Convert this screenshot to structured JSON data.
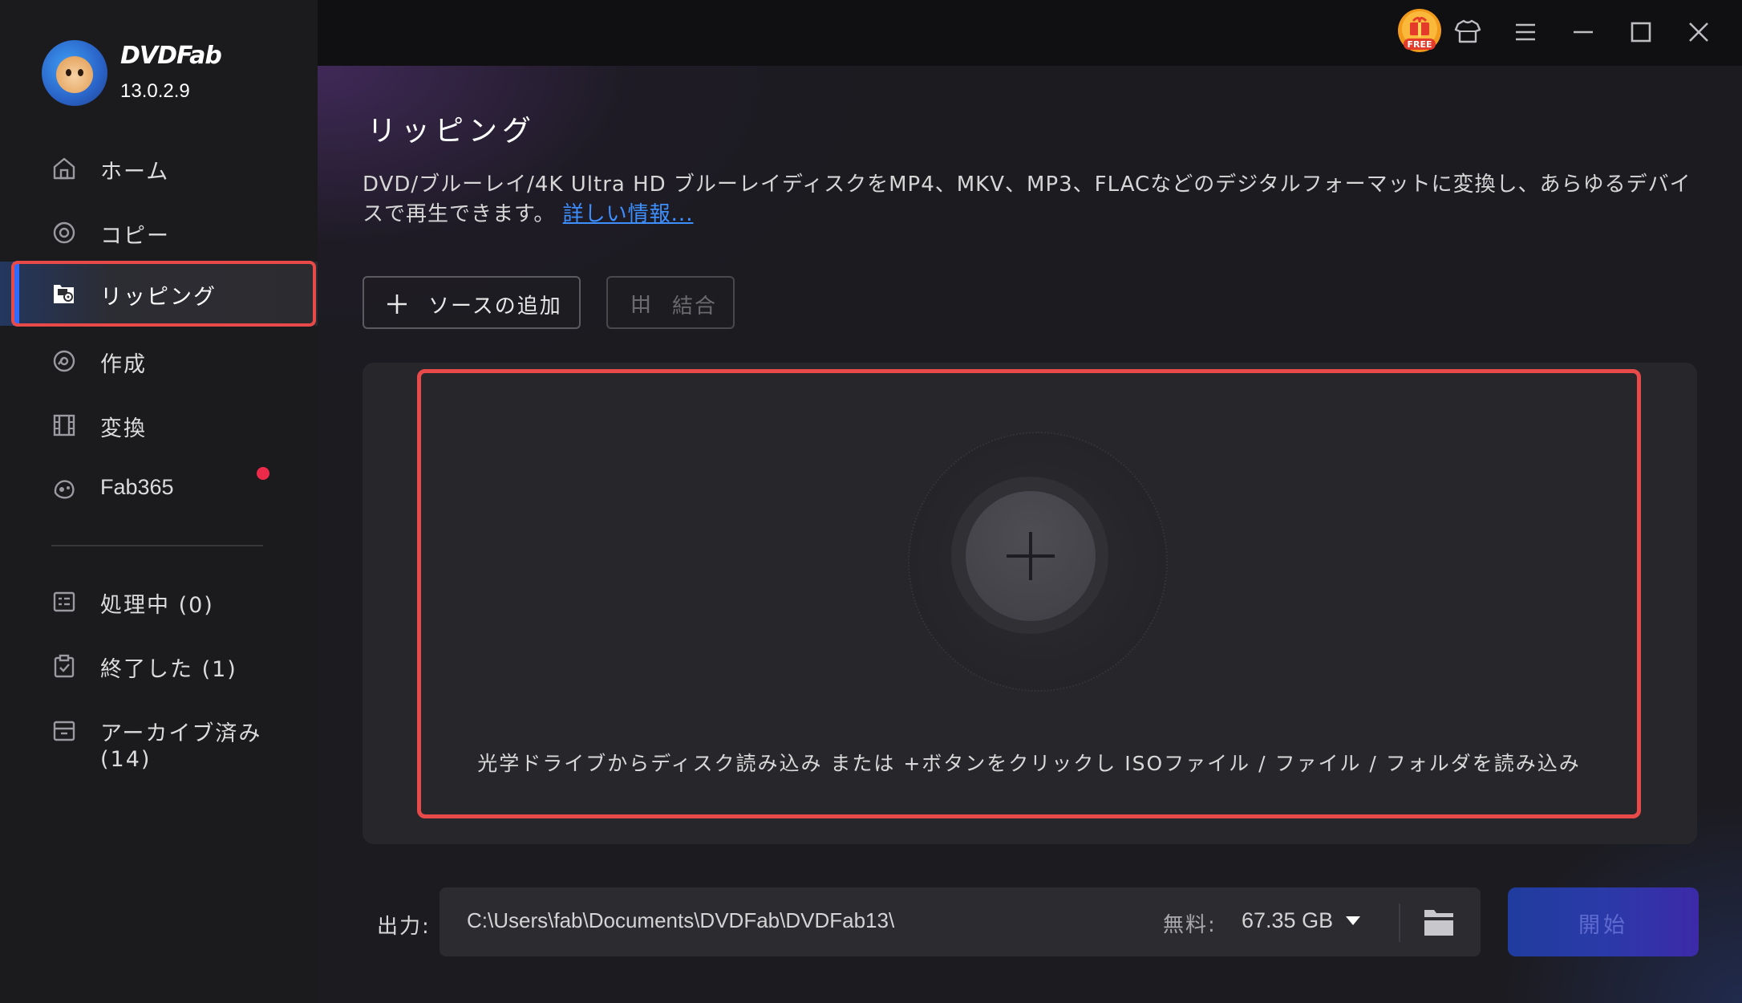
{
  "app": {
    "brand": "DVDFab",
    "version": "13.0.2.9"
  },
  "sidebar": {
    "items": [
      {
        "label": "ホーム",
        "icon": "home-icon"
      },
      {
        "label": "コピー",
        "icon": "copy-disc-icon"
      },
      {
        "label": "リッピング",
        "icon": "ripping-icon",
        "active": true
      },
      {
        "label": "作成",
        "icon": "create-disc-icon"
      },
      {
        "label": "変換",
        "icon": "convert-film-icon"
      },
      {
        "label": "Fab365",
        "icon": "fab365-icon",
        "badge": "red-dot"
      }
    ],
    "tasks": [
      {
        "label": "処理中 (0)",
        "icon": "processing-list-icon"
      },
      {
        "label": "終了した (1)",
        "icon": "finished-clipboard-icon"
      },
      {
        "label": "アーカイブ済み (14)",
        "icon": "archive-box-icon"
      }
    ]
  },
  "topbar": {
    "icons": [
      "free-gift-icon",
      "tshirt-skin-icon",
      "menu-icon",
      "minimize-icon",
      "maximize-icon",
      "close-icon"
    ],
    "free_badge": "FREE"
  },
  "main": {
    "title": "リッピング",
    "description": "DVD/ブルーレイ/4K Ultra HD ブルーレイディスクをMP4、MKV、MP3、FLACなどのデジタルフォーマットに変換し、あらゆるデバイスで再生できます。",
    "more_link": "詳しい情報...",
    "add_source_label": "ソースの追加",
    "merge_label": "結合",
    "drop_hint": "光学ドライブからディスク読み込み または +ボタンをクリックし ISOファイル / ファイル / フォルダを読み込み"
  },
  "output": {
    "label": "出力:",
    "path": "C:\\Users\\fab\\Documents\\DVDFab\\DVDFab13\\",
    "free_label": "無料:",
    "free_value": "67.35 GB",
    "start_label": "開始"
  },
  "colors": {
    "accent_blue": "#2f6bff",
    "highlight_red": "#e84a4a",
    "badge_red": "#ee2a4a",
    "link_blue": "#3d8fff"
  }
}
